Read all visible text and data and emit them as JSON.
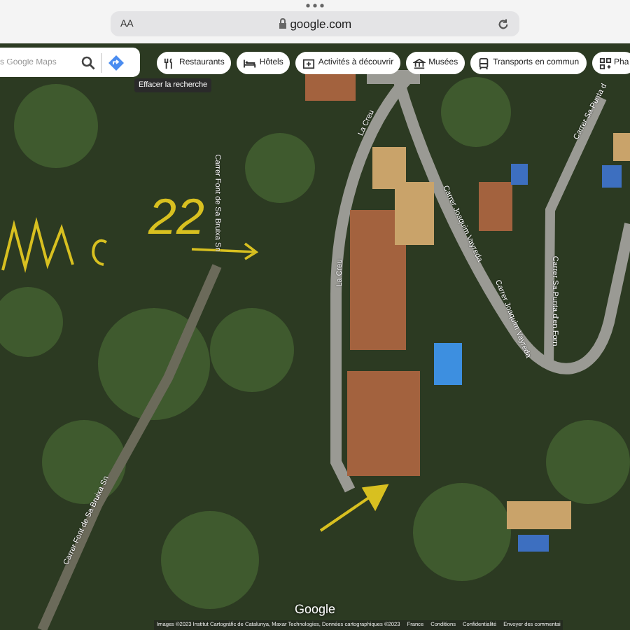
{
  "browser": {
    "text_size": "AA",
    "url": "google.com"
  },
  "map": {
    "search": {
      "placeholder": "s Google Maps"
    },
    "chips": [
      {
        "kind": "restaurant",
        "label": "Restaurants"
      },
      {
        "kind": "hotel",
        "label": "Hôtels"
      },
      {
        "kind": "activity",
        "label": "Activités à découvrir"
      },
      {
        "kind": "museum",
        "label": "Musées"
      },
      {
        "kind": "transit",
        "label": "Transports en commun"
      },
      {
        "kind": "pharmacy",
        "label": "Pha"
      }
    ],
    "tooltip": "Effacer la recherche",
    "street_labels": [
      "Carrer Font de Sa Bruixa Sn",
      "Carrer Font de Sa Bruixa Sn",
      "La Creu",
      "La Creu",
      "Carrer Joaquim Vayreda",
      "Carrer Joaquim Vayreda",
      "Carrer Sa Punta d'en Forn",
      "Carrer Sa Punta d"
    ],
    "annotation": "22",
    "logo": "Google",
    "footer": [
      "Images ©2023 Institut Cartogràfic de Catalunya, Maxar Technologies, Données cartographiques ©2023",
      "France",
      "Conditions",
      "Confidentialité",
      "Envoyer des commentai"
    ]
  }
}
